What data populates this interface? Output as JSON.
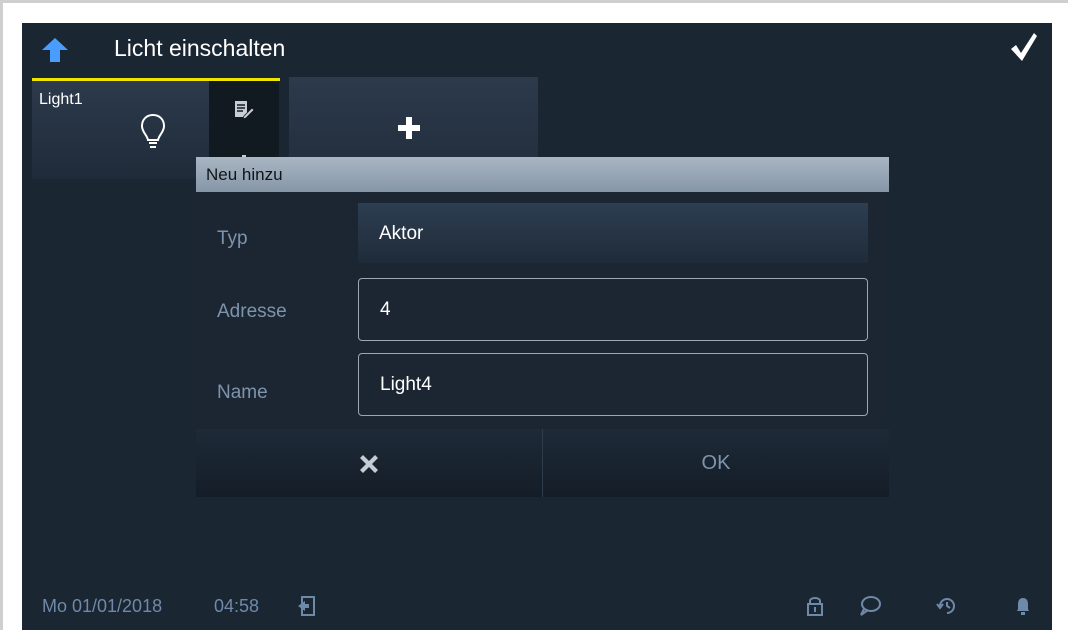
{
  "header": {
    "title": "Licht einschalten",
    "back_icon": "back-arrow-icon",
    "confirm_icon": "checkmark-icon"
  },
  "tiles": [
    {
      "label": "Light1",
      "icon": "light-bulb-icon"
    }
  ],
  "edit_icon": "edit-icon",
  "add_icon": "plus-icon",
  "dialog": {
    "title": "Neu hinzu",
    "rows": [
      {
        "label": "Typ",
        "value": "Aktor"
      },
      {
        "label": "Adresse",
        "value": "4"
      },
      {
        "label": "Name",
        "value": "Light4"
      }
    ],
    "cancel_icon": "close-icon",
    "ok_label": "OK"
  },
  "status_bar": {
    "date": "Mo 01/01/2018",
    "time": "04:58",
    "icons": [
      "logout-icon",
      "lock-icon",
      "message-icon",
      "history-icon",
      "bell-icon"
    ]
  },
  "colors": {
    "background": "#1b2633",
    "accent_underline": "#f1e400",
    "dialog_header": "#9aa9b8",
    "muted_text": "#7d94ad"
  }
}
